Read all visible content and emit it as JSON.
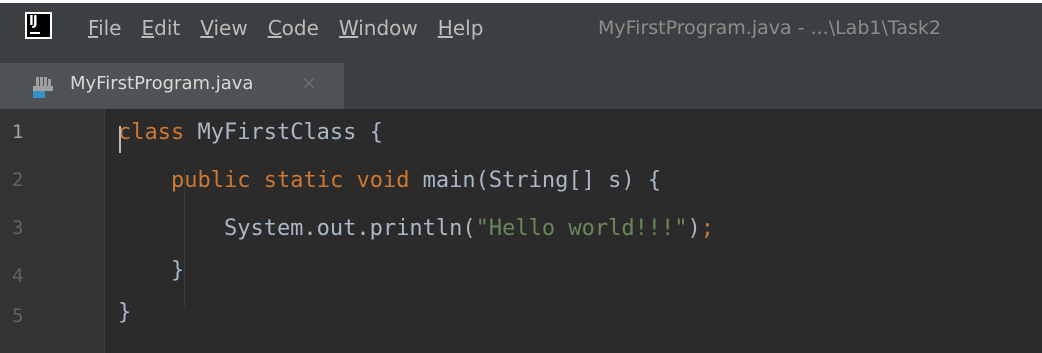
{
  "colors": {
    "menubar_bg": "#3c3f41",
    "editor_bg": "#2b2b2b",
    "keyword": "#cc7832",
    "string": "#6a8759",
    "text": "#a9b7c6"
  },
  "app_logo": {
    "text": "IJ",
    "icon": "intellij-logo-icon"
  },
  "menu": [
    {
      "mnemonic": "F",
      "rest": "ile"
    },
    {
      "mnemonic": "E",
      "rest": "dit"
    },
    {
      "mnemonic": "V",
      "rest": "iew"
    },
    {
      "mnemonic": "C",
      "rest": "ode"
    },
    {
      "mnemonic": "W",
      "rest": "indow"
    },
    {
      "mnemonic": "H",
      "rest": "elp"
    }
  ],
  "window_title": "MyFirstProgram.java - ...\\Lab1\\Task2",
  "tab": {
    "label": "MyFirstProgram.java",
    "close": "×",
    "icon": "java-file-icon"
  },
  "editor": {
    "line_numbers": [
      "1",
      "2",
      "3",
      "4",
      "5"
    ],
    "lines": [
      [
        {
          "t": "class",
          "c": "kw"
        },
        {
          "t": " MyFirstClass {",
          "c": "plain"
        }
      ],
      [
        {
          "t": "    ",
          "c": "plain"
        },
        {
          "t": "public",
          "c": "kw"
        },
        {
          "t": " ",
          "c": "plain"
        },
        {
          "t": "static",
          "c": "kw"
        },
        {
          "t": " ",
          "c": "plain"
        },
        {
          "t": "void",
          "c": "kw"
        },
        {
          "t": " main(String[] s) {",
          "c": "plain"
        }
      ],
      [
        {
          "t": "        System.out.println(",
          "c": "plain"
        },
        {
          "t": "\"Hello world!!!\"",
          "c": "str"
        },
        {
          "t": ")",
          "c": "plain"
        },
        {
          "t": ";",
          "c": "semi"
        }
      ],
      [
        {
          "t": "    }",
          "c": "plain"
        }
      ],
      [
        {
          "t": "}",
          "c": "plain"
        }
      ]
    ]
  }
}
